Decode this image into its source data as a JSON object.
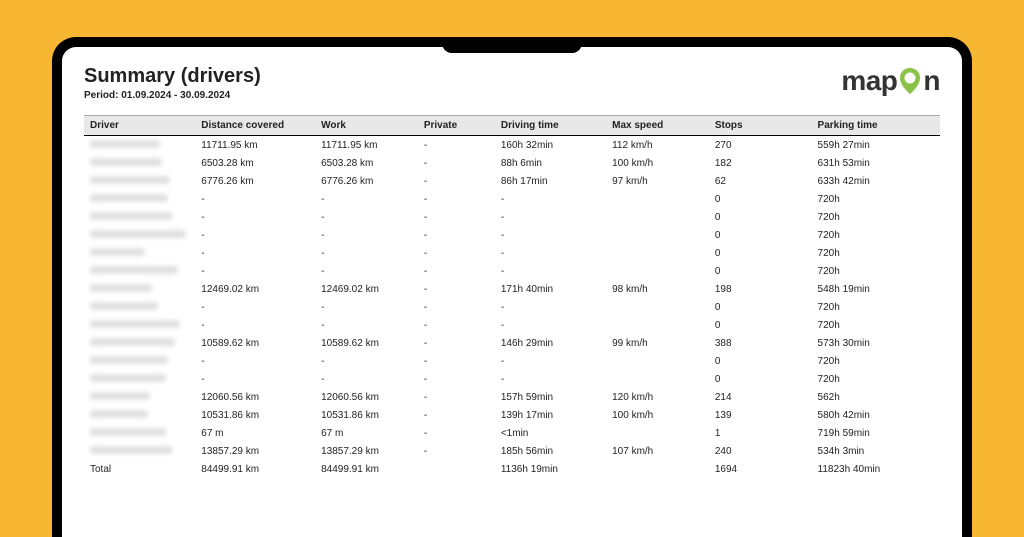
{
  "header": {
    "title": "Summary (drivers)",
    "period_label": "Period: 01.09.2024 - 30.09.2024",
    "logo_prefix": "map",
    "logo_suffix": "n"
  },
  "columns": [
    "Driver",
    "Distance covered",
    "Work",
    "Private",
    "Driving time",
    "Max speed",
    "Stops",
    "Parking time"
  ],
  "rows": [
    {
      "name_width": 70,
      "distance": "11711.95 km",
      "work": "11711.95 km",
      "private": "-",
      "driving": "160h 32min",
      "maxspeed": "112 km/h",
      "stops": "270",
      "parking": "559h 27min"
    },
    {
      "name_width": 72,
      "distance": "6503.28 km",
      "work": "6503.28 km",
      "private": "-",
      "driving": "88h 6min",
      "maxspeed": "100 km/h",
      "stops": "182",
      "parking": "631h 53min"
    },
    {
      "name_width": 80,
      "distance": "6776.26 km",
      "work": "6776.26 km",
      "private": "-",
      "driving": "86h 17min",
      "maxspeed": "97 km/h",
      "stops": "62",
      "parking": "633h 42min"
    },
    {
      "name_width": 78,
      "distance": "-",
      "work": "-",
      "private": "-",
      "driving": "-",
      "maxspeed": "",
      "stops": "0",
      "parking": "720h"
    },
    {
      "name_width": 82,
      "distance": "-",
      "work": "-",
      "private": "-",
      "driving": "-",
      "maxspeed": "",
      "stops": "0",
      "parking": "720h"
    },
    {
      "name_width": 96,
      "distance": "-",
      "work": "-",
      "private": "-",
      "driving": "-",
      "maxspeed": "",
      "stops": "0",
      "parking": "720h"
    },
    {
      "name_width": 55,
      "distance": "-",
      "work": "-",
      "private": "-",
      "driving": "-",
      "maxspeed": "",
      "stops": "0",
      "parking": "720h"
    },
    {
      "name_width": 88,
      "distance": "-",
      "work": "-",
      "private": "-",
      "driving": "-",
      "maxspeed": "",
      "stops": "0",
      "parking": "720h"
    },
    {
      "name_width": 62,
      "distance": "12469.02 km",
      "work": "12469.02 km",
      "private": "-",
      "driving": "171h 40min",
      "maxspeed": "98 km/h",
      "stops": "198",
      "parking": "548h 19min"
    },
    {
      "name_width": 68,
      "distance": "-",
      "work": "-",
      "private": "-",
      "driving": "-",
      "maxspeed": "",
      "stops": "0",
      "parking": "720h"
    },
    {
      "name_width": 90,
      "distance": "-",
      "work": "-",
      "private": "-",
      "driving": "-",
      "maxspeed": "",
      "stops": "0",
      "parking": "720h"
    },
    {
      "name_width": 85,
      "distance": "10589.62 km",
      "work": "10589.62 km",
      "private": "-",
      "driving": "146h 29min",
      "maxspeed": "99 km/h",
      "stops": "388",
      "parking": "573h 30min"
    },
    {
      "name_width": 78,
      "distance": "-",
      "work": "-",
      "private": "-",
      "driving": "-",
      "maxspeed": "",
      "stops": "0",
      "parking": "720h"
    },
    {
      "name_width": 76,
      "distance": "-",
      "work": "-",
      "private": "-",
      "driving": "-",
      "maxspeed": "",
      "stops": "0",
      "parking": "720h"
    },
    {
      "name_width": 60,
      "distance": "12060.56 km",
      "work": "12060.56 km",
      "private": "-",
      "driving": "157h 59min",
      "maxspeed": "120 km/h",
      "stops": "214",
      "parking": "562h"
    },
    {
      "name_width": 58,
      "distance": "10531.86 km",
      "work": "10531.86 km",
      "private": "-",
      "driving": "139h 17min",
      "maxspeed": "100 km/h",
      "stops": "139",
      "parking": "580h 42min"
    },
    {
      "name_width": 76,
      "distance": "67 m",
      "work": "67 m",
      "private": "-",
      "driving": "<1min",
      "maxspeed": "",
      "stops": "1",
      "parking": "719h 59min"
    },
    {
      "name_width": 82,
      "distance": "13857.29 km",
      "work": "13857.29 km",
      "private": "-",
      "driving": "185h 56min",
      "maxspeed": "107 km/h",
      "stops": "240",
      "parking": "534h 3min"
    }
  ],
  "total": {
    "label": "Total",
    "distance": "84499.91 km",
    "work": "84499.91 km",
    "private": "",
    "driving": "1136h 19min",
    "maxspeed": "",
    "stops": "1694",
    "parking": "11823h 40min"
  }
}
